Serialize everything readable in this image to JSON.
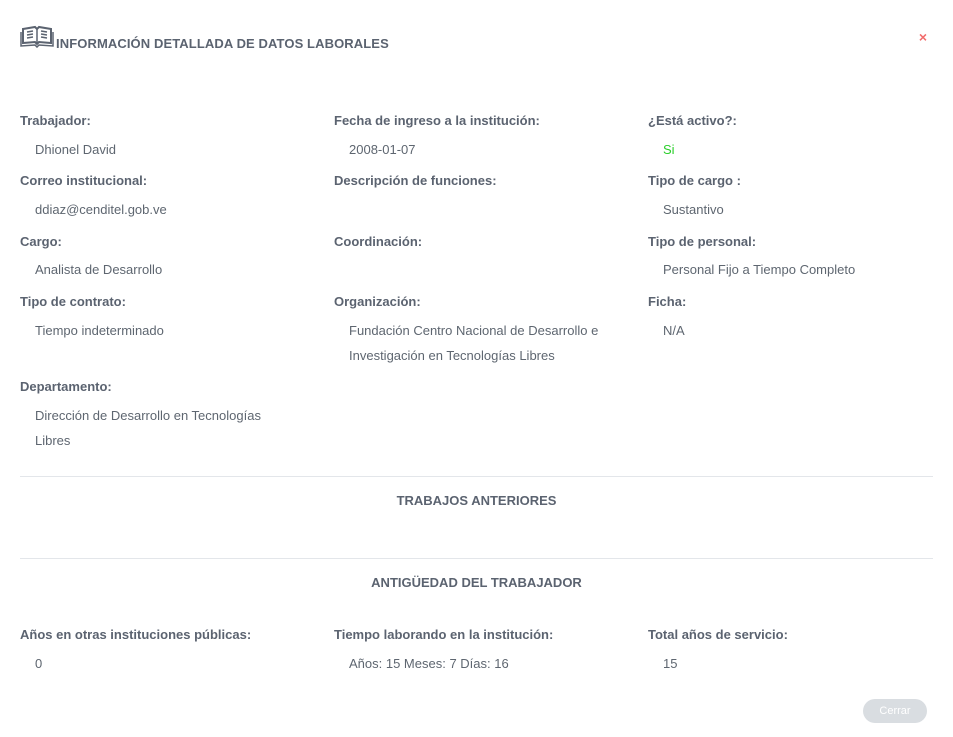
{
  "modal": {
    "title": "INFORMACIÓN DETALLADA DE DATOS LABORALES",
    "close_symbol": "×",
    "icon": "book-icon"
  },
  "details": {
    "trabajador": {
      "label": "Trabajador:",
      "value": "Dhionel David"
    },
    "fecha_ingreso": {
      "label": "Fecha de ingreso a la institución:",
      "value": "2008-01-07"
    },
    "activo": {
      "label": "¿Está activo?:",
      "value": "Si"
    },
    "correo": {
      "label": "Correo institucional:",
      "value": "ddiaz@cenditel.gob.ve"
    },
    "descripcion": {
      "label": "Descripción de funciones:",
      "value": ""
    },
    "tipo_cargo": {
      "label": "Tipo de cargo :",
      "value": "Sustantivo"
    },
    "cargo": {
      "label": "Cargo:",
      "value": "Analista de Desarrollo"
    },
    "coordinacion": {
      "label": "Coordinación:",
      "value": ""
    },
    "tipo_personal": {
      "label": "Tipo de personal:",
      "value": "Personal Fijo a Tiempo Completo"
    },
    "tipo_contrato": {
      "label": "Tipo de contrato:",
      "value": "Tiempo indeterminado"
    },
    "organizacion": {
      "label": "Organización:",
      "value": "Fundación Centro Nacional de Desarrollo e Investigación en Tecnologías Libres"
    },
    "ficha": {
      "label": "Ficha:",
      "value": "N/A"
    },
    "departamento": {
      "label": "Departamento:",
      "value": "Dirección de Desarrollo en Tecnologías Libres"
    }
  },
  "sections": {
    "trabajos_anteriores": "TRABAJOS ANTERIORES",
    "antiguedad": "ANTIGÜEDAD DEL TRABAJADOR"
  },
  "antiguedad": {
    "otras_instituciones": {
      "label": "Años en otras instituciones públicas:",
      "value": "0"
    },
    "tiempo_institucion": {
      "label": "Tiempo laborando en la institución:",
      "value": "Años: 15 Meses: 7 Días: 16"
    },
    "total_servicio": {
      "label": "Total años de servicio:",
      "value": "15"
    }
  },
  "footer": {
    "close_label": "Cerrar"
  },
  "colors": {
    "active": "#2ccf2c",
    "close": "#f26b6b",
    "button_bg": "#d9dde1"
  }
}
